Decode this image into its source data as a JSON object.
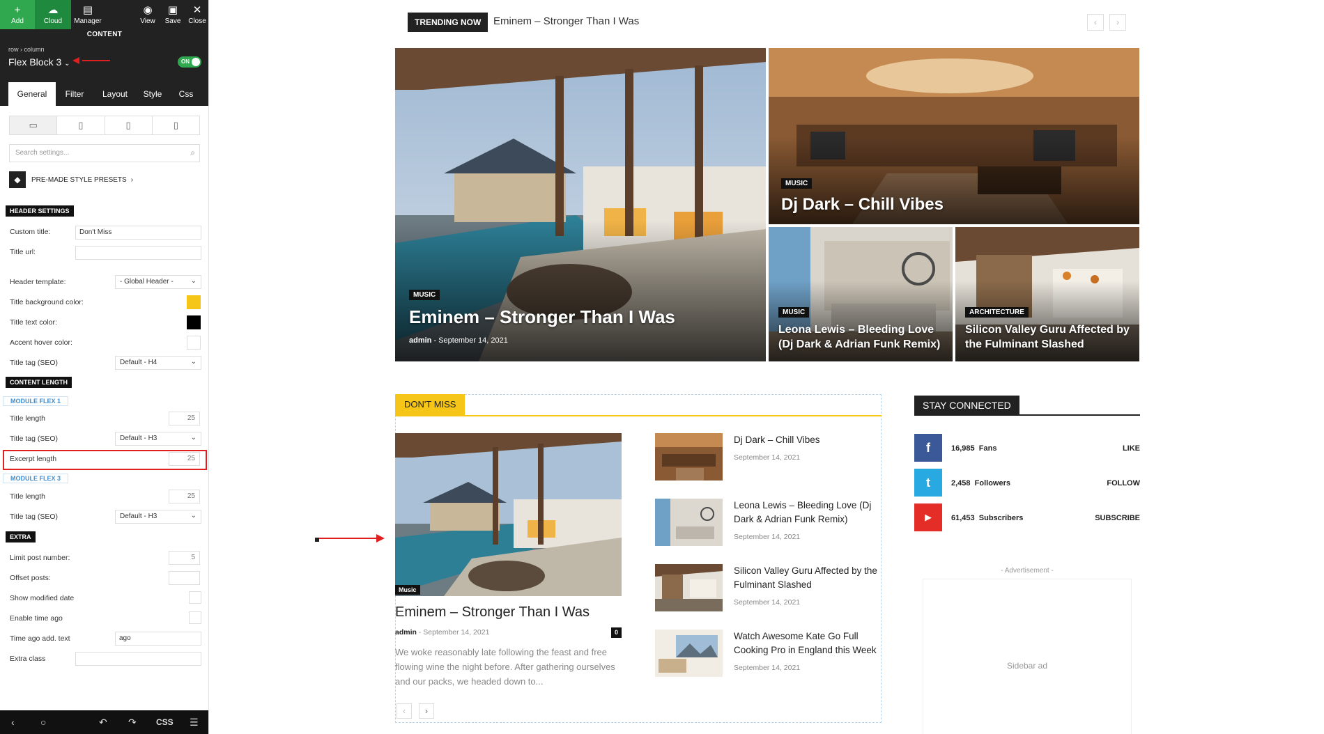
{
  "panel": {
    "toolbar": {
      "add": "Add",
      "cloud": "Cloud",
      "manager": "Manager",
      "view": "View",
      "save": "Save",
      "close": "Close",
      "section_label": "CONTENT"
    },
    "breadcrumb": "row › column",
    "block_name": "Flex Block 3",
    "on_label": "ON",
    "tabs": [
      "General",
      "Filter",
      "Layout",
      "Style",
      "Css"
    ],
    "search_placeholder": "Search settings...",
    "presets_label": "PRE-MADE STYLE PRESETS",
    "header_settings": {
      "title": "HEADER SETTINGS",
      "custom_title_label": "Custom title:",
      "custom_title_value": "Don't Miss",
      "title_url_label": "Title url:",
      "header_template_label": "Header template:",
      "header_template_value": "- Global Header -",
      "title_bg_label": "Title background color:",
      "title_bg_color": "#f5c518",
      "title_text_label": "Title text color:",
      "title_text_color": "#000000",
      "accent_hover_label": "Accent hover color:",
      "title_tag_label": "Title tag (SEO)",
      "title_tag_value": "Default - H4"
    },
    "content_length": {
      "title": "CONTENT LENGTH",
      "module1": "MODULE FLEX 1",
      "m1_title_length_label": "Title length",
      "m1_title_length_value": "25",
      "m1_title_tag_label": "Title tag (SEO)",
      "m1_title_tag_value": "Default - H3",
      "m1_excerpt_label": "Excerpt length",
      "m1_excerpt_value": "25",
      "module3": "MODULE FLEX 3",
      "m3_title_length_label": "Title length",
      "m3_title_length_value": "25",
      "m3_title_tag_label": "Title tag (SEO)",
      "m3_title_tag_value": "Default - H3"
    },
    "extra": {
      "title": "EXTRA",
      "limit_label": "Limit post number:",
      "limit_value": "5",
      "offset_label": "Offset posts:",
      "show_modified_label": "Show modified date",
      "time_ago_label": "Enable time ago",
      "time_ago_text_label": "Time ago add. text",
      "time_ago_text_value": "ago",
      "extra_class_label": "Extra class"
    },
    "bottom": {
      "css": "CSS"
    }
  },
  "trending": {
    "badge": "TRENDING NOW",
    "title": "Eminem – Stronger Than I Was"
  },
  "featured": {
    "main": {
      "category": "MUSIC",
      "title": "Eminem – Stronger Than I Was",
      "author": "admin",
      "date": "September 14, 2021"
    },
    "top_right": {
      "category": "MUSIC",
      "title": "Dj Dark – Chill Vibes"
    },
    "bottom_left": {
      "category": "MUSIC",
      "title": "Leona Lewis – Bleeding Love (Dj Dark & Adrian Funk Remix)"
    },
    "bottom_right": {
      "category": "ARCHITECTURE",
      "title": "Silicon Valley Guru Affected by the Fulminant Slashed"
    }
  },
  "dont_miss": {
    "header": "DON'T MISS",
    "big": {
      "category": "Music",
      "title": "Eminem – Stronger Than I Was",
      "author": "admin",
      "date": "September 14, 2021",
      "comments": "0",
      "excerpt": "We woke reasonably late following the feast and free flowing wine the night before. After gathering ourselves and our packs, we headed down to..."
    },
    "list": [
      {
        "title": "Dj Dark – Chill Vibes",
        "date": "September 14, 2021"
      },
      {
        "title": "Leona Lewis – Bleeding Love (Dj Dark & Adrian Funk Remix)",
        "date": "September 14, 2021"
      },
      {
        "title": "Silicon Valley Guru Affected by the Fulminant Slashed",
        "date": "September 14, 2021"
      },
      {
        "title": "Watch Awesome Kate Go Full Cooking Pro in England this Week",
        "date": "September 14, 2021"
      }
    ]
  },
  "sidebar": {
    "header": "STAY CONNECTED",
    "social": [
      {
        "count": "16,985",
        "unit": "Fans",
        "action": "LIKE",
        "color": "#3b5998",
        "icon": "facebook-icon",
        "glyph": "f"
      },
      {
        "count": "2,458",
        "unit": "Followers",
        "action": "FOLLOW",
        "color": "#29a9e1",
        "icon": "twitter-icon",
        "glyph": "t"
      },
      {
        "count": "61,453",
        "unit": "Subscribers",
        "action": "SUBSCRIBE",
        "color": "#e52d27",
        "icon": "youtube-icon",
        "glyph": "▶"
      }
    ],
    "ad_label": "- Advertisement -",
    "ad_text": "Sidebar ad"
  }
}
